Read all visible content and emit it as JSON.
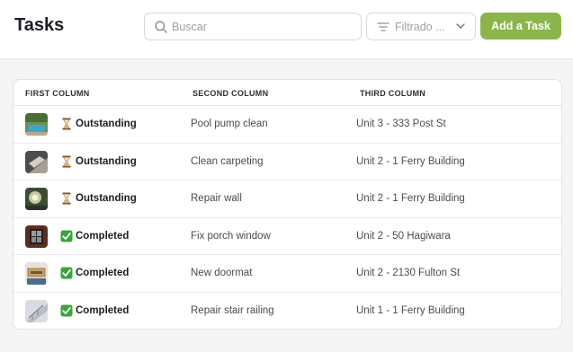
{
  "header": {
    "title": "Tasks",
    "search": {
      "placeholder": "Buscar",
      "icon": "search-icon"
    },
    "filter": {
      "label": "Filtrado ...",
      "icon": "filter-icon"
    },
    "add_button_label": "Add a Task",
    "accent_color": "#8bb54a"
  },
  "table": {
    "columns": [
      "FIRST COLUMN",
      "SECOND COLUMN",
      "THIRD COLUMN"
    ],
    "rows": [
      {
        "thumbnail": "pool-photo",
        "status_icon": "hourglass-icon",
        "status": "Outstanding",
        "task": "Pool pump clean",
        "location": "Unit 3 - 333 Post St"
      },
      {
        "thumbnail": "carpet-photo",
        "status_icon": "hourglass-icon",
        "status": "Outstanding",
        "task": "Clean carpeting",
        "location": "Unit 2 - 1 Ferry Building"
      },
      {
        "thumbnail": "wall-photo",
        "status_icon": "hourglass-icon",
        "status": "Outstanding",
        "task": "Repair wall",
        "location": "Unit 2 - 1 Ferry Building"
      },
      {
        "thumbnail": "window-photo",
        "status_icon": "checkmark-icon",
        "status": "Completed",
        "task": "Fix porch window",
        "location": "Unit 2 - 50 Hagiwara"
      },
      {
        "thumbnail": "doormat-photo",
        "status_icon": "checkmark-icon",
        "status": "Completed",
        "task": "New doormat",
        "location": "Unit 2 - 2130 Fulton St"
      },
      {
        "thumbnail": "railing-photo",
        "status_icon": "checkmark-icon",
        "status": "Completed",
        "task": "Repair stair railing",
        "location": "Unit 1 - 1 Ferry Building"
      }
    ]
  }
}
